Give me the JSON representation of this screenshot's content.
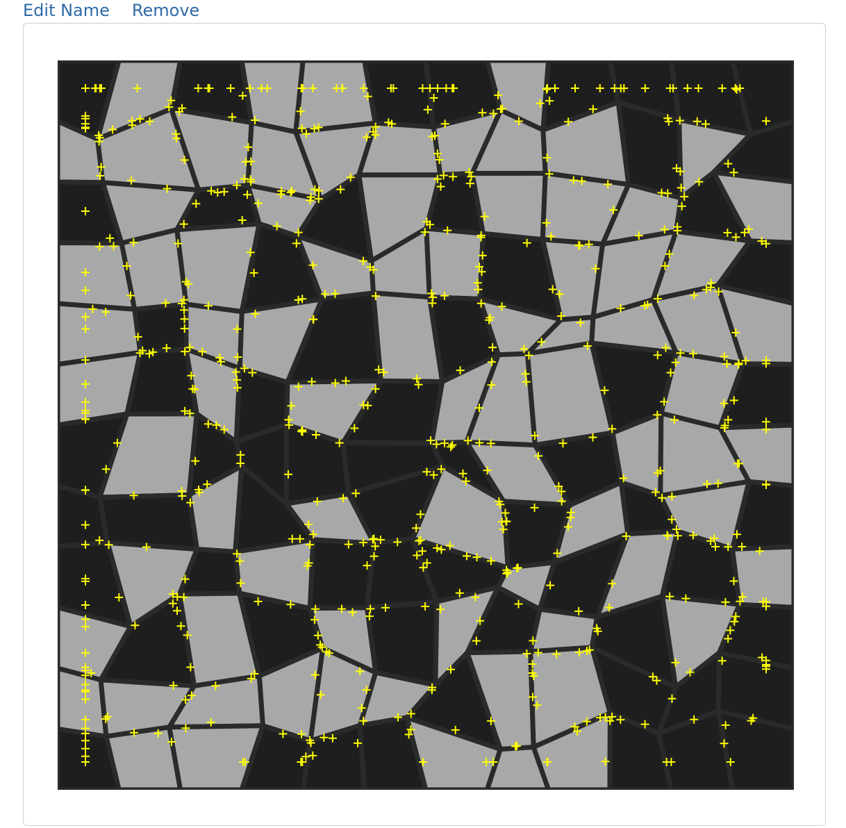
{
  "actions": {
    "edit_label": "Edit Name",
    "remove_label": "Remove"
  },
  "image": {
    "description_icon": "crack-pattern-with-feature-markers",
    "marker_color": "#ffff00",
    "marker_symbol": "+"
  },
  "colors": {
    "link": "#2f6aa8",
    "border": "#d0d0d0",
    "dark_tile": "#1e1e1e",
    "light_tile": "#a8a8a8"
  }
}
